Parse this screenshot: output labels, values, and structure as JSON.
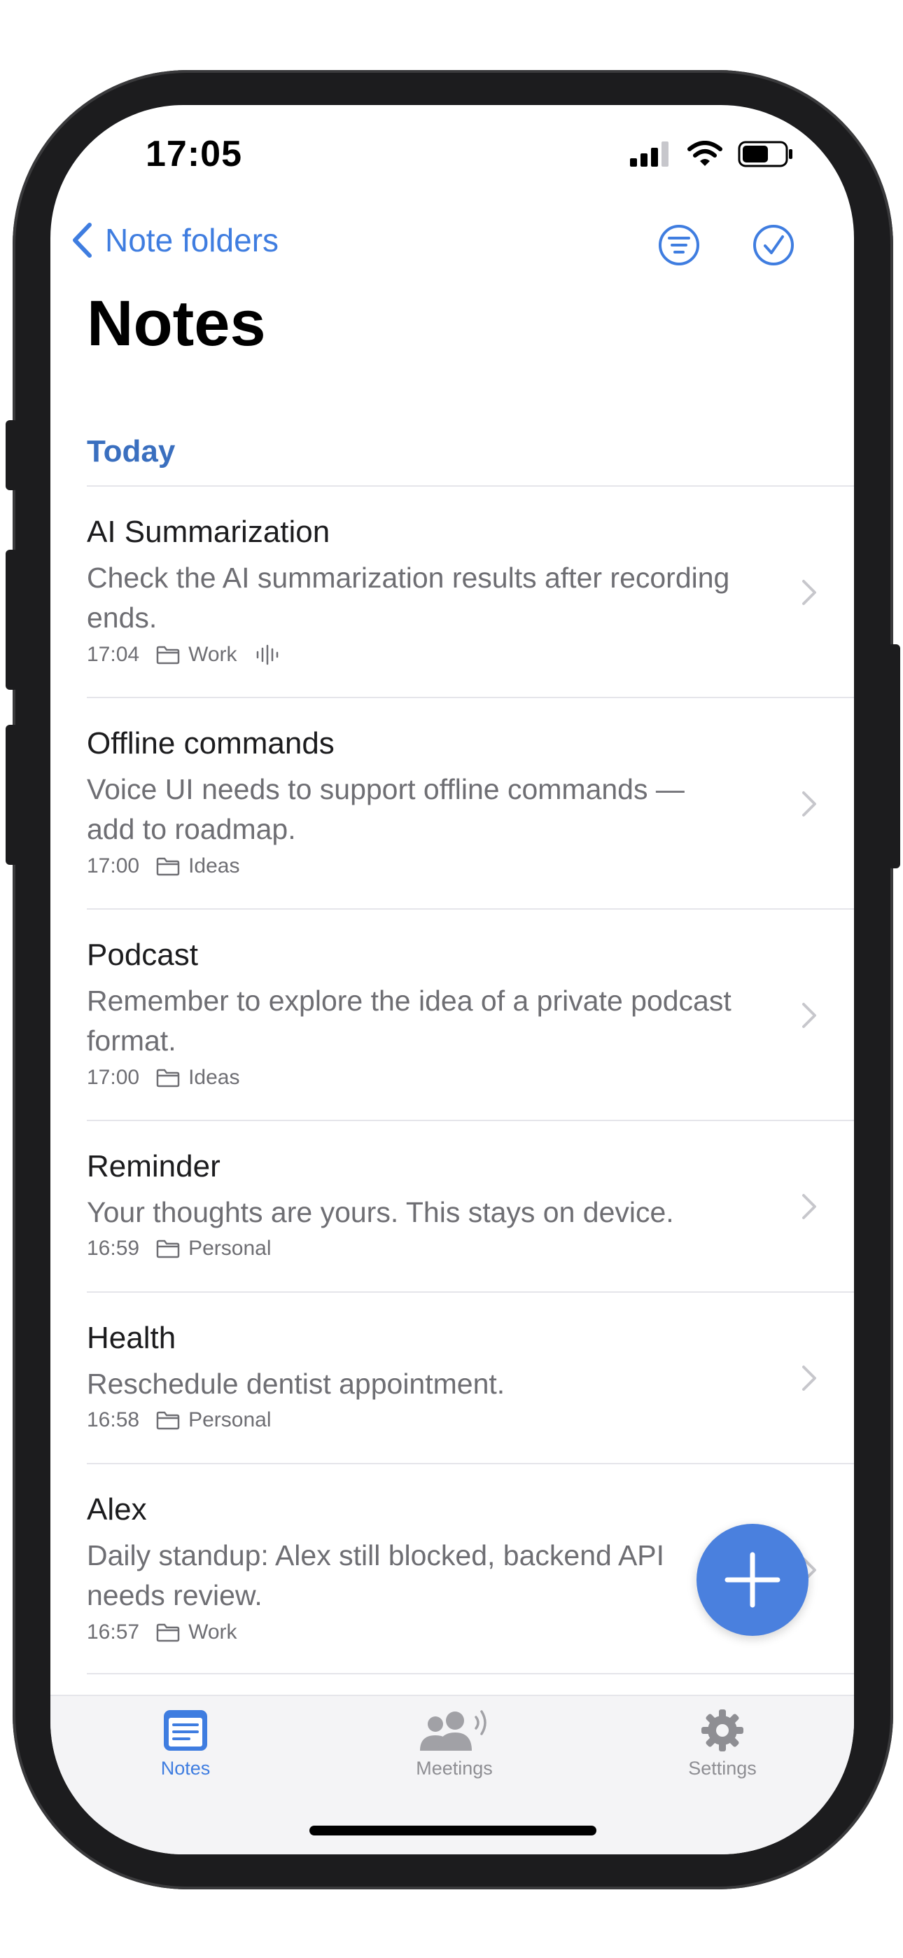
{
  "status_bar": {
    "time": "17:05",
    "signal_icon": "cellular-signal-icon",
    "wifi_icon": "wifi-icon",
    "battery_icon": "battery-icon"
  },
  "nav": {
    "back_label": "Note folders",
    "filter_icon": "filter-icon",
    "select_icon": "checkmark-circle-icon"
  },
  "page": {
    "title": "Notes",
    "section_label": "Today"
  },
  "notes": [
    {
      "title": "AI Summarization",
      "body": "Check the AI summarization results after recording ends.",
      "time": "17:04",
      "folder": "Work",
      "has_audio": true
    },
    {
      "title": "Offline commands",
      "body": "Voice UI needs to support offline commands — add to roadmap.",
      "time": "17:00",
      "folder": "Ideas",
      "has_audio": false
    },
    {
      "title": "Podcast",
      "body": "Remember to explore the idea of a private podcast format.",
      "time": "17:00",
      "folder": "Ideas",
      "has_audio": false
    },
    {
      "title": "Reminder",
      "body": "Your thoughts are yours. This stays on device.",
      "time": "16:59",
      "folder": "Personal",
      "has_audio": false
    },
    {
      "title": "Health",
      "body": "Reschedule dentist appointment.",
      "time": "16:58",
      "folder": "Personal",
      "has_audio": false
    },
    {
      "title": "Alex",
      "body": "Daily standup: Alex still blocked, backend API needs review.",
      "time": "16:57",
      "folder": "Work",
      "has_audio": false
    }
  ],
  "fab": {
    "icon": "plus-icon"
  },
  "tab_bar": {
    "tabs": [
      {
        "label": "Notes",
        "icon": "notes-icon",
        "active": true
      },
      {
        "label": "Meetings",
        "icon": "meetings-icon",
        "active": false
      },
      {
        "label": "Settings",
        "icon": "gear-icon",
        "active": false
      }
    ]
  },
  "colors": {
    "accent": "#3f7de0",
    "section_header": "#3a6fbf",
    "fab": "#4a80de",
    "secondary_text": "#6e6e73",
    "inactive_tab": "#8e8e93"
  }
}
